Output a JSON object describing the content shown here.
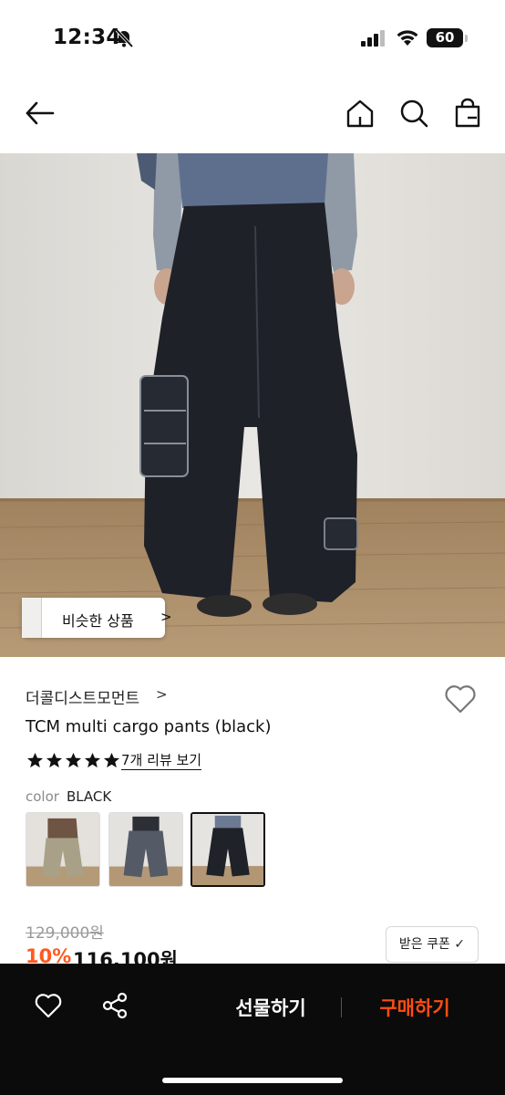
{
  "status_bar": {
    "time": "12:34",
    "battery": "60"
  },
  "nav": {
    "icons": [
      "back-arrow-icon",
      "home-icon",
      "search-icon",
      "shopping-bag-icon"
    ]
  },
  "hero": {
    "similar_button_label": "비슷한 상품",
    "similar_chevron": ">"
  },
  "product": {
    "brand": "더콜디스트모먼트",
    "brand_chevron": ">",
    "title": "TCM multi cargo pants (black)",
    "rating_stars": 5,
    "review_link": "7개 리뷰 보기",
    "color_label": "color",
    "color_value": "BLACK",
    "swatches": [
      "beige",
      "grey",
      "black"
    ],
    "selected_swatch": "black",
    "original_price": "129,000원",
    "discount": "10%",
    "sale_price": "116,100원",
    "coupon_button": "받은 쿠폰 ✓"
  },
  "bottom_bar": {
    "gift_label": "선물하기",
    "buy_label": "구매하기",
    "buy_color": "#ff4d12"
  }
}
